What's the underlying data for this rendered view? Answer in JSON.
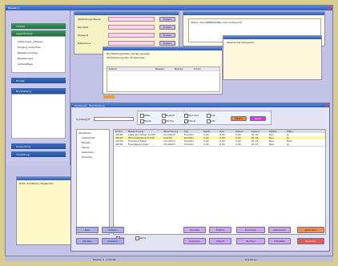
{
  "app": {
    "title": "Weeder 4",
    "status_left": "Weeder 4 - Initialen",
    "status_right": "Kreditoren"
  },
  "sidebar": {
    "group1_label": "Verkauf",
    "group2_label": "Lager/Einkauf",
    "items": [
      "Lieferungen erfassen",
      "Eingang verbuchen",
      "Bestellvorschlag",
      "Bestellungen",
      "Artikelpflege"
    ],
    "group3_label": "Kunden",
    "group4_label": "Buchhaltung",
    "items2": [
      "Kontoblatt",
      "Offene Posten",
      "Zahlungsverkehr",
      "Mahnwesen",
      "Kassenbuch",
      "Abschlussbuchungen",
      "Journal",
      "Kontenrahmen",
      "Kontenplan",
      "Steuerschluessel"
    ],
    "group5_label": "Auswertung",
    "group6_label": "Verwaltung",
    "group7_label": "Werkzeuge"
  },
  "form_window": {
    "fields": [
      "Verbindungs-Name",
      "Benutzer",
      "Passwort",
      "Datenbank"
    ],
    "button_label": "Ändern"
  },
  "info_window_text": "Status: SQL-VERBINDUNG (not configured)",
  "list_window": {
    "line1": "Buchhaltungsdaten werden geladen",
    "line2": "Aktualisierung alle 30 Sekunden",
    "headers": [
      "Datum",
      "Belegnr",
      "Betrag",
      "Konto"
    ]
  },
  "status_window_text": "Verbindung erfolgreich",
  "notes_window_text": "Notiz: Kreditoren abgleichen",
  "main": {
    "title": "Kreditoren - Buchhaltung",
    "search_label": "Suchbegriff",
    "filters": [
      "Offen",
      "Bezahlt",
      "Storniert",
      "Alle",
      "Heute",
      "Woche",
      "Monat",
      "Jahr"
    ],
    "orange_btn": "Filtern",
    "magenta_btn": "Reset",
    "tree": [
      "Kreditoren",
      "Lieferanten",
      "Banken",
      "Steuer",
      "Gebühren",
      "Diverses"
    ],
    "headers": [
      "Konto",
      "Bezeichnung",
      "Abrechnung",
      "Typ",
      "Saldo",
      "Soll",
      "Haben",
      "Datum",
      "Status",
      "Mahn"
    ],
    "rows": [
      [
        "40100",
        "Lieferant Müller GmbH",
        "monatlich",
        "Kreditor",
        "0.00",
        "0.00",
        "0.00",
        "01.01.",
        "Neu",
        "Ja"
      ],
      [
        "40120",
        "Büromaterial Schmidt",
        "quartal",
        "Kreditor",
        "0.00",
        "0.00",
        "0.00",
        "01.01.",
        "Neu",
        "Ja"
      ],
      [
        "40130",
        "Transport Meier",
        "monatlich",
        "Kreditor",
        "0.00",
        "0.00",
        "0.00",
        "01.01.",
        "Neu",
        "Nein"
      ],
      [
        "40140",
        "Energieversorger",
        "monatlich",
        "Kreditor",
        "0.00",
        "0.00",
        "0.00",
        "01.01.",
        "Neu",
        "Ja"
      ]
    ],
    "check_all": "Alle",
    "check_none": "Keine",
    "buttons_left": [
      "Neu",
      "Ändern",
      "Löschen",
      "Kopieren"
    ],
    "buttons_mid": [
      "Drucken",
      "Export",
      "Vorschau",
      "Import"
    ],
    "buttons_right": [
      "Zuordnen",
      "Buchen",
      "Abbrechen",
      "Schließen"
    ],
    "buttons_far": [
      "Speichern",
      "Beenden"
    ]
  }
}
